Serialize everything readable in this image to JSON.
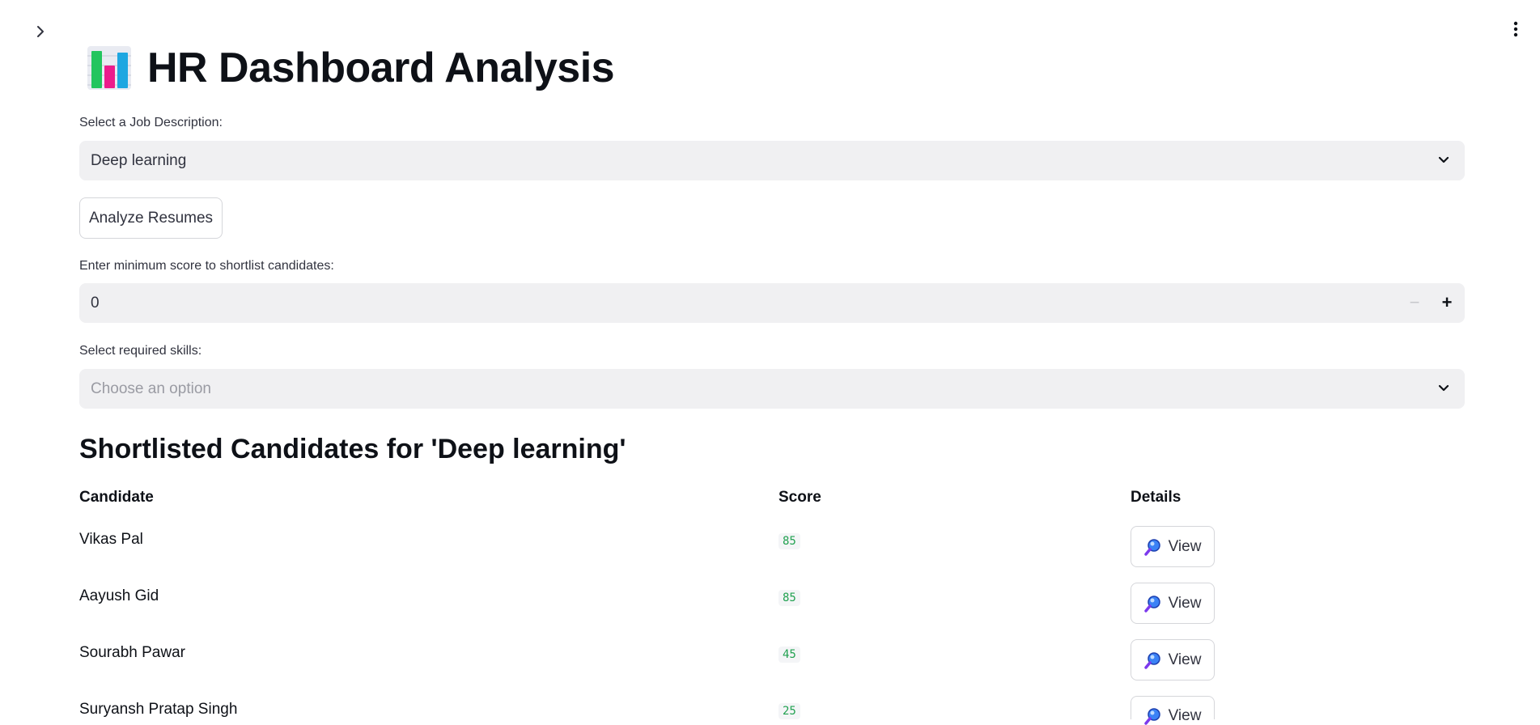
{
  "page": {
    "title": "HR Dashboard Analysis",
    "title_icon": "bar-chart-emoji"
  },
  "job_select": {
    "label": "Select a Job Description:",
    "value": "Deep learning"
  },
  "analyze_button": {
    "label": "Analyze Resumes"
  },
  "min_score": {
    "label": "Enter minimum score to shortlist candidates:",
    "value": "0",
    "minus_label": "−",
    "plus_label": "+"
  },
  "skills_select": {
    "label": "Select required skills:",
    "placeholder": "Choose an option"
  },
  "shortlist": {
    "heading": "Shortlisted Candidates for 'Deep learning'",
    "columns": {
      "candidate": "Candidate",
      "score": "Score",
      "details": "Details"
    },
    "view_label": "View",
    "rows": [
      {
        "name": "Vikas Pal",
        "score": "85"
      },
      {
        "name": "Aayush Gid",
        "score": "85"
      },
      {
        "name": "Sourabh Pawar",
        "score": "45"
      },
      {
        "name": "Suryansh Pratap Singh",
        "score": "25"
      }
    ]
  },
  "colors": {
    "field_bg": "#f0f0f2",
    "score_text": "#21a150",
    "heading": "#0e1117"
  }
}
